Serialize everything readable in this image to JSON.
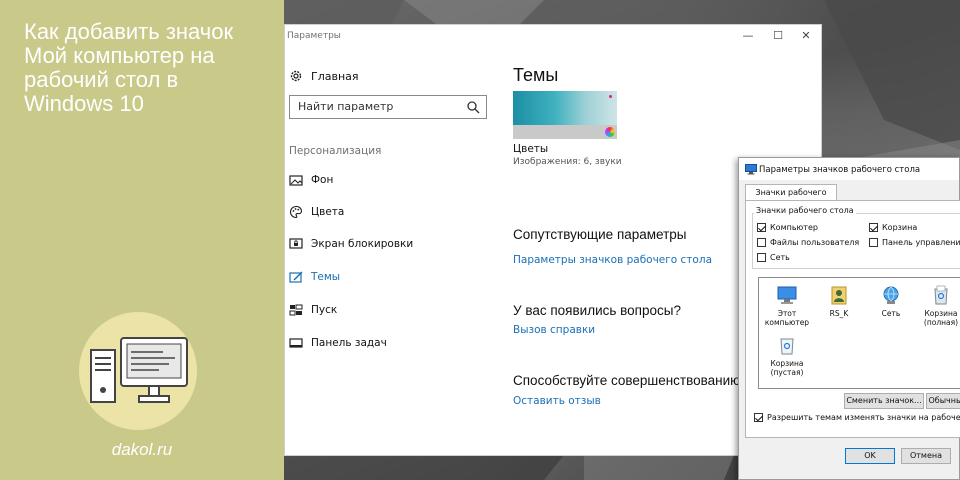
{
  "banner": {
    "title_lines": [
      "Как добавить значок",
      "Мой компьютер на",
      "рабочий стол в",
      "Windows 10"
    ],
    "site": "dakol.ru"
  },
  "settings": {
    "window_title": "Параметры",
    "controls": {
      "minimize": "—",
      "maximize": "☐",
      "close": "✕"
    },
    "home_label": "Главная",
    "search_placeholder": "Найти параметр",
    "section_label": "Персонализация",
    "nav": [
      {
        "label": "Фон",
        "icon": "image-icon",
        "active": false
      },
      {
        "label": "Цвета",
        "icon": "palette-icon",
        "active": false
      },
      {
        "label": "Экран блокировки",
        "icon": "lock-screen-icon",
        "active": false
      },
      {
        "label": "Темы",
        "icon": "themes-icon",
        "active": true
      },
      {
        "label": "Пуск",
        "icon": "start-icon",
        "active": false
      },
      {
        "label": "Панель задач",
        "icon": "taskbar-icon",
        "active": false
      }
    ],
    "main": {
      "title": "Темы",
      "theme_name": "Цветы",
      "theme_desc": "Изображения: 6, звуки",
      "related_heading": "Сопутствующие параметры",
      "related_link": "Параметры значков рабочего стола",
      "questions_heading": "У вас появились вопросы?",
      "questions_link": "Вызов справки",
      "improve_heading": "Способствуйте совершенствованию",
      "improve_link": "Оставить отзыв"
    }
  },
  "dialog": {
    "title": "Параметры значков рабочего стола",
    "tab": "Значки рабочего стола",
    "group_label": "Значки рабочего стола",
    "checkboxes": [
      {
        "label": "Компьютер",
        "checked": true
      },
      {
        "label": "Корзина",
        "checked": true
      },
      {
        "label": "Файлы пользователя",
        "checked": false
      },
      {
        "label": "Панель управления",
        "checked": false
      },
      {
        "label": "Сеть",
        "checked": false
      }
    ],
    "icons": [
      {
        "label": "Этот компьютер",
        "icon": "computer-icon"
      },
      {
        "label": "RS_K",
        "icon": "user-folder-icon"
      },
      {
        "label": "Сеть",
        "icon": "network-icon"
      },
      {
        "label": "Корзина (полная)",
        "icon": "recycle-bin-full-icon"
      },
      {
        "label": "Корзина (пустая)",
        "icon": "recycle-bin-empty-icon"
      }
    ],
    "change_icon_button": "Сменить значок...",
    "default_button": "Обычный",
    "allow_themes_label": "Разрешить темам изменять значки на рабочем столе",
    "allow_themes_checked": true,
    "ok_button": "OK",
    "cancel_button": "Отмена"
  }
}
